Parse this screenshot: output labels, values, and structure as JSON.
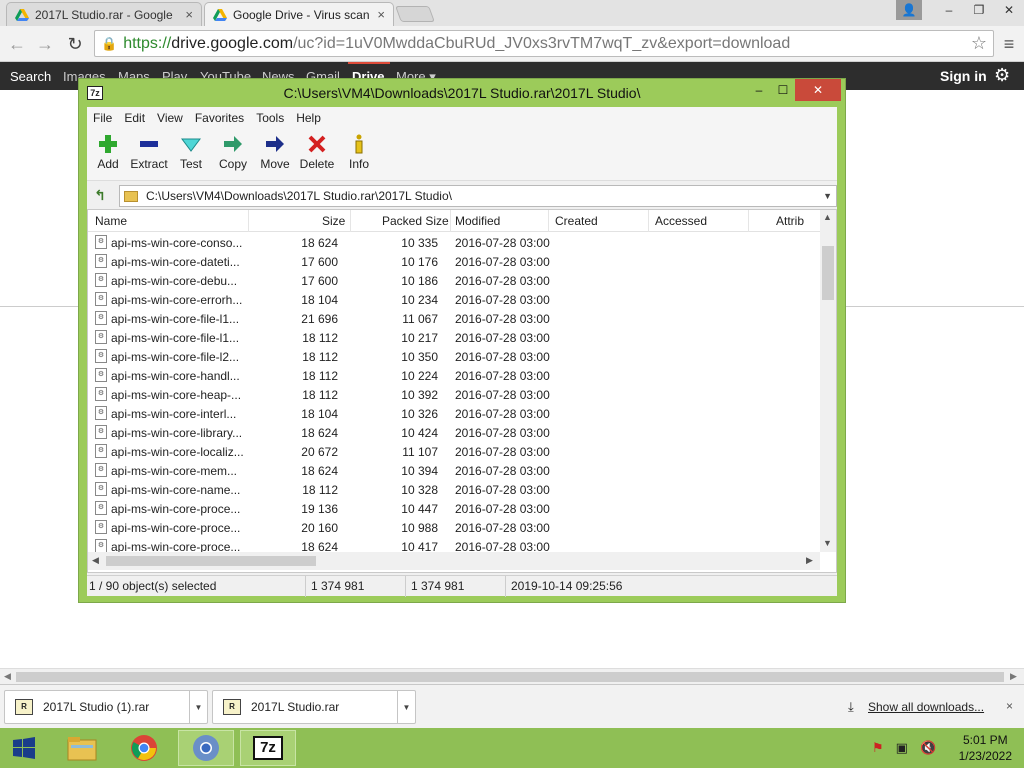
{
  "browser": {
    "tabs": [
      {
        "label": "2017L Studio.rar - Google",
        "close": "×"
      },
      {
        "label": "Google Drive - Virus scan",
        "close": "×"
      }
    ],
    "window_controls": {
      "user": "👤",
      "minimize": "–",
      "maximize": "❐",
      "close": "✕"
    },
    "address": {
      "scheme": "https://",
      "host": "drive.google.com",
      "path": "/uc?id=1uV0MwddaCbuRUd_JV0xs3rvTM7wqT_zv&export=download"
    },
    "google_bar": {
      "links": [
        "Search",
        "Images",
        "Maps",
        "Play",
        "YouTube",
        "News",
        "Gmail",
        "Drive",
        "More ▾"
      ],
      "selected": "Drive",
      "sign_in": "Sign in"
    }
  },
  "sevenzip": {
    "title": "C:\\Users\\VM4\\Downloads\\2017L Studio.rar\\2017L Studio\\",
    "menu": [
      "File",
      "Edit",
      "View",
      "Favorites",
      "Tools",
      "Help"
    ],
    "toolbar": [
      {
        "label": "Add",
        "icon": "plus-icon"
      },
      {
        "label": "Extract",
        "icon": "minus-icon"
      },
      {
        "label": "Test",
        "icon": "check-icon"
      },
      {
        "label": "Copy",
        "icon": "copy-arrow-icon"
      },
      {
        "label": "Move",
        "icon": "move-arrow-icon"
      },
      {
        "label": "Delete",
        "icon": "delete-x-icon"
      },
      {
        "label": "Info",
        "icon": "info-icon"
      }
    ],
    "path": "C:\\Users\\VM4\\Downloads\\2017L Studio.rar\\2017L Studio\\",
    "columns": [
      "Name",
      "Size",
      "Packed Size",
      "Modified",
      "Created",
      "Accessed",
      "Attrib"
    ],
    "rows": [
      {
        "name": "api-ms-win-core-conso...",
        "size": "18 624",
        "packed": "10 335",
        "modified": "2016-07-28 03:00"
      },
      {
        "name": "api-ms-win-core-dateti...",
        "size": "17 600",
        "packed": "10 176",
        "modified": "2016-07-28 03:00"
      },
      {
        "name": "api-ms-win-core-debu...",
        "size": "17 600",
        "packed": "10 186",
        "modified": "2016-07-28 03:00"
      },
      {
        "name": "api-ms-win-core-errorh...",
        "size": "18 104",
        "packed": "10 234",
        "modified": "2016-07-28 03:00"
      },
      {
        "name": "api-ms-win-core-file-l1...",
        "size": "21 696",
        "packed": "11 067",
        "modified": "2016-07-28 03:00"
      },
      {
        "name": "api-ms-win-core-file-l1...",
        "size": "18 112",
        "packed": "10 217",
        "modified": "2016-07-28 03:00"
      },
      {
        "name": "api-ms-win-core-file-l2...",
        "size": "18 112",
        "packed": "10 350",
        "modified": "2016-07-28 03:00"
      },
      {
        "name": "api-ms-win-core-handl...",
        "size": "18 112",
        "packed": "10 224",
        "modified": "2016-07-28 03:00"
      },
      {
        "name": "api-ms-win-core-heap-...",
        "size": "18 112",
        "packed": "10 392",
        "modified": "2016-07-28 03:00"
      },
      {
        "name": "api-ms-win-core-interl...",
        "size": "18 104",
        "packed": "10 326",
        "modified": "2016-07-28 03:00"
      },
      {
        "name": "api-ms-win-core-library...",
        "size": "18 624",
        "packed": "10 424",
        "modified": "2016-07-28 03:00"
      },
      {
        "name": "api-ms-win-core-localiz...",
        "size": "20 672",
        "packed": "11 107",
        "modified": "2016-07-28 03:00"
      },
      {
        "name": "api-ms-win-core-mem...",
        "size": "18 624",
        "packed": "10 394",
        "modified": "2016-07-28 03:00"
      },
      {
        "name": "api-ms-win-core-name...",
        "size": "18 112",
        "packed": "10 328",
        "modified": "2016-07-28 03:00"
      },
      {
        "name": "api-ms-win-core-proce...",
        "size": "19 136",
        "packed": "10 447",
        "modified": "2016-07-28 03:00"
      },
      {
        "name": "api-ms-win-core-proce...",
        "size": "20 160",
        "packed": "10 988",
        "modified": "2016-07-28 03:00"
      },
      {
        "name": "api-ms-win-core-proce...",
        "size": "18 624",
        "packed": "10 417",
        "modified": "2016-07-28 03:00"
      }
    ],
    "status": {
      "selected": "1 / 90 object(s) selected",
      "size": "1 374 981",
      "packed": "1 374 981",
      "date": "2019-10-14 09:25:56"
    }
  },
  "downloads": {
    "items": [
      "2017L Studio (1).rar",
      "2017L Studio.rar"
    ],
    "show_all": "Show all downloads...",
    "close": "×"
  },
  "taskbar": {
    "time": "5:01 PM",
    "date": "1/23/2022"
  },
  "colors": {
    "window_frame": "#9ccb5a",
    "taskbar": "#8fbf55",
    "close_red": "#c94a3a",
    "google_bar": "#2d2d2d"
  }
}
